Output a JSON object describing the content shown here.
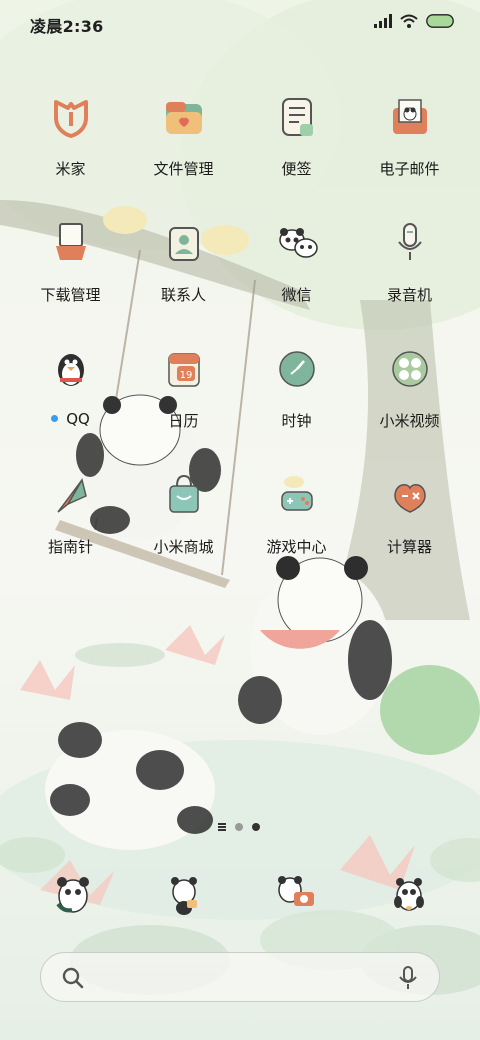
{
  "status_bar": {
    "time": "凌晨2:36",
    "battery_color": "#a8d89a"
  },
  "apps": [
    {
      "id": "mijia",
      "label": "米家",
      "icon": "mijia-icon"
    },
    {
      "id": "files",
      "label": "文件管理",
      "icon": "folder-icon"
    },
    {
      "id": "notes",
      "label": "便签",
      "icon": "notes-icon"
    },
    {
      "id": "email",
      "label": "电子邮件",
      "icon": "email-icon"
    },
    {
      "id": "downloads",
      "label": "下载管理",
      "icon": "download-icon"
    },
    {
      "id": "contacts",
      "label": "联系人",
      "icon": "contacts-icon"
    },
    {
      "id": "wechat",
      "label": "微信",
      "icon": "wechat-panda-icon"
    },
    {
      "id": "recorder",
      "label": "录音机",
      "icon": "microphone-icon"
    },
    {
      "id": "qq",
      "label": "QQ",
      "icon": "qq-penguin-icon",
      "has_notification_dot": true
    },
    {
      "id": "calendar",
      "label": "日历",
      "icon": "calendar-icon",
      "badge_text": "19"
    },
    {
      "id": "clock",
      "label": "时钟",
      "icon": "clock-icon"
    },
    {
      "id": "video",
      "label": "小米视频",
      "icon": "video-icon"
    },
    {
      "id": "compass",
      "label": "指南针",
      "icon": "compass-icon"
    },
    {
      "id": "mall",
      "label": "小米商城",
      "icon": "shopping-bag-icon"
    },
    {
      "id": "games",
      "label": "游戏中心",
      "icon": "gamepad-icon"
    },
    {
      "id": "calculator",
      "label": "计算器",
      "icon": "calculator-icon"
    }
  ],
  "pager": {
    "pages": 2,
    "current": 2
  },
  "dock": [
    {
      "id": "dock-phone",
      "icon": "panda-phone-icon"
    },
    {
      "id": "dock-messages",
      "icon": "panda-messages-icon"
    },
    {
      "id": "dock-camera",
      "icon": "panda-camera-icon"
    },
    {
      "id": "dock-browser",
      "icon": "panda-browser-icon"
    }
  ],
  "search_bar": {
    "placeholder": ""
  },
  "colors": {
    "accent_blue": "#3a9bef",
    "icon_orange": "#e0805a",
    "icon_green": "#7fb59a"
  }
}
